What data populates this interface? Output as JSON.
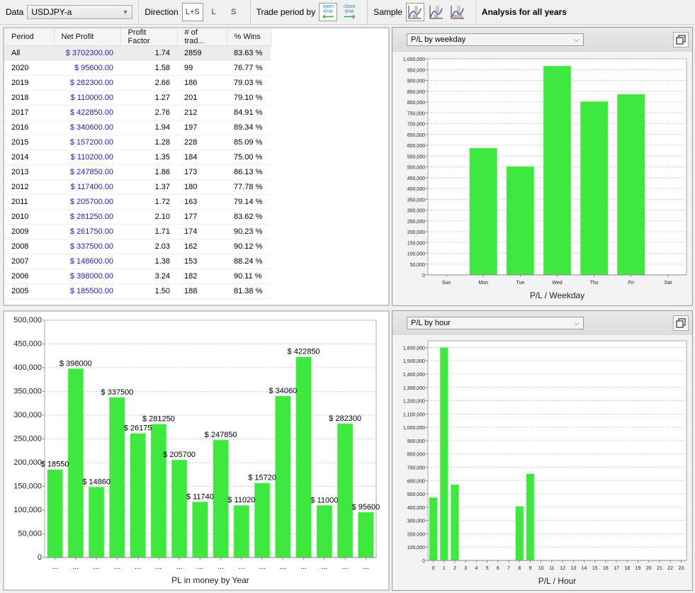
{
  "toolbar": {
    "data_label": "Data",
    "data_value": "USDJPY-a",
    "direction_label": "Direction",
    "direction_options": [
      "L+S",
      "L",
      "S"
    ],
    "direction_selected": "L+S",
    "trade_period_label": "Trade period by",
    "open_time": {
      "line1": "open",
      "line2": "time",
      "icon": "arrow-left-icon"
    },
    "close_time": {
      "line1": "close",
      "line2": "time",
      "icon": "arrow-right-icon"
    },
    "sample_label": "Sample",
    "sample_options": [
      "all",
      "is",
      "oos"
    ],
    "sample_selected": "all",
    "analysis_title": "Analysis for all years"
  },
  "table": {
    "columns": [
      "Period",
      "Net Profit",
      "Profit Factor",
      "# of trad...",
      "% Wins"
    ],
    "rows": [
      {
        "period": "All",
        "net_profit": "$ 3702300.00",
        "profit_factor": "1.74",
        "trades": "2859",
        "wins": "83.63 %"
      },
      {
        "period": "2020",
        "net_profit": "$ 95600.00",
        "profit_factor": "1.58",
        "trades": "99",
        "wins": "76.77 %"
      },
      {
        "period": "2019",
        "net_profit": "$ 282300.00",
        "profit_factor": "2.66",
        "trades": "186",
        "wins": "79.03 %"
      },
      {
        "period": "2018",
        "net_profit": "$ 110000.00",
        "profit_factor": "1.27",
        "trades": "201",
        "wins": "79.10 %"
      },
      {
        "period": "2017",
        "net_profit": "$ 422850.00",
        "profit_factor": "2.76",
        "trades": "212",
        "wins": "84.91 %"
      },
      {
        "period": "2016",
        "net_profit": "$ 340600.00",
        "profit_factor": "1.94",
        "trades": "197",
        "wins": "89.34 %"
      },
      {
        "period": "2015",
        "net_profit": "$ 157200.00",
        "profit_factor": "1.28",
        "trades": "228",
        "wins": "85.09 %"
      },
      {
        "period": "2014",
        "net_profit": "$ 110200.00",
        "profit_factor": "1.35",
        "trades": "184",
        "wins": "75.00 %"
      },
      {
        "period": "2013",
        "net_profit": "$ 247850.00",
        "profit_factor": "1.86",
        "trades": "173",
        "wins": "86.13 %"
      },
      {
        "period": "2012",
        "net_profit": "$ 117400.00",
        "profit_factor": "1.37",
        "trades": "180",
        "wins": "77.78 %"
      },
      {
        "period": "2011",
        "net_profit": "$ 205700.00",
        "profit_factor": "1.72",
        "trades": "163",
        "wins": "79.14 %"
      },
      {
        "period": "2010",
        "net_profit": "$ 281250.00",
        "profit_factor": "2.10",
        "trades": "177",
        "wins": "83.62 %"
      },
      {
        "period": "2009",
        "net_profit": "$ 261750.00",
        "profit_factor": "1.71",
        "trades": "174",
        "wins": "90.23 %"
      },
      {
        "period": "2008",
        "net_profit": "$ 337500.00",
        "profit_factor": "2.03",
        "trades": "162",
        "wins": "90.12 %"
      },
      {
        "period": "2007",
        "net_profit": "$ 148600.00",
        "profit_factor": "1.38",
        "trades": "153",
        "wins": "88.24 %"
      },
      {
        "period": "2006",
        "net_profit": "$ 398000.00",
        "profit_factor": "3.24",
        "trades": "182",
        "wins": "90.11 %"
      },
      {
        "period": "2005",
        "net_profit": "$ 185500.00",
        "profit_factor": "1.50",
        "trades": "188",
        "wins": "81.38 %"
      }
    ]
  },
  "weekday_panel": {
    "selector_value": "P/L by weekday",
    "maximize_icon": "maximize-icon"
  },
  "hour_panel": {
    "selector_value": "P/L by hour",
    "maximize_icon": "maximize-icon"
  },
  "colors": {
    "bar": "#3ee83e",
    "net_profit_text": "#2020c0"
  },
  "chart_data": [
    {
      "id": "weekday",
      "type": "bar",
      "title": "",
      "xlabel": "P/L / Weekday",
      "ylabel": "",
      "categories": [
        "Sun",
        "Mon",
        "Tue",
        "Wed",
        "Thu",
        "Fri",
        "Sat"
      ],
      "values": [
        0,
        587000,
        502000,
        967000,
        803000,
        836000,
        0
      ],
      "ylim": [
        0,
        1000000
      ],
      "ytick_step": 50000,
      "grid": true,
      "legend": "none"
    },
    {
      "id": "year",
      "type": "bar",
      "title": "",
      "xlabel": "PL in money by Year",
      "ylabel": "",
      "categories": [
        "...",
        "...",
        "...",
        "...",
        "...",
        "...",
        "...",
        "...",
        "...",
        "...",
        "...",
        "...",
        "...",
        "...",
        "...",
        "..."
      ],
      "years": [
        "2005",
        "2006",
        "2007",
        "2008",
        "2009",
        "2010",
        "2011",
        "2012",
        "2013",
        "2014",
        "2015",
        "2016",
        "2017",
        "2018",
        "2019",
        "2020"
      ],
      "values": [
        185500,
        398000,
        148600,
        337500,
        261750,
        281250,
        205700,
        117400,
        247850,
        110200,
        157200,
        340600,
        422850,
        110000,
        282300,
        95600
      ],
      "data_labels": [
        "$ 18550",
        "$ 398000",
        "$ 14860",
        "$ 337500",
        "$ 26175",
        "$ 281250",
        "$ 205700",
        "$ 11740",
        "$ 247850",
        "$ 11020",
        "$ 15720",
        "$ 34060",
        "$ 422850",
        "$ 11000",
        "$ 282300",
        "$ 95600"
      ],
      "ylim": [
        0,
        500000
      ],
      "ytick_step": 50000,
      "grid": true,
      "legend": "none"
    },
    {
      "id": "hour",
      "type": "bar",
      "title": "",
      "xlabel": "P/L / Hour",
      "ylabel": "",
      "categories": [
        "0",
        "1",
        "2",
        "3",
        "4",
        "5",
        "6",
        "7",
        "8",
        "9",
        "10",
        "11",
        "12",
        "13",
        "14",
        "15",
        "16",
        "17",
        "18",
        "19",
        "20",
        "21",
        "22",
        "23"
      ],
      "values": [
        472000,
        1600000,
        570000,
        0,
        0,
        0,
        0,
        0,
        407000,
        651000,
        0,
        0,
        0,
        0,
        0,
        0,
        0,
        0,
        0,
        0,
        0,
        0,
        0,
        0
      ],
      "ylim": [
        0,
        1650000
      ],
      "ytick_step": 100000,
      "ytick_max": 1600000,
      "grid": true,
      "legend": "none"
    }
  ]
}
